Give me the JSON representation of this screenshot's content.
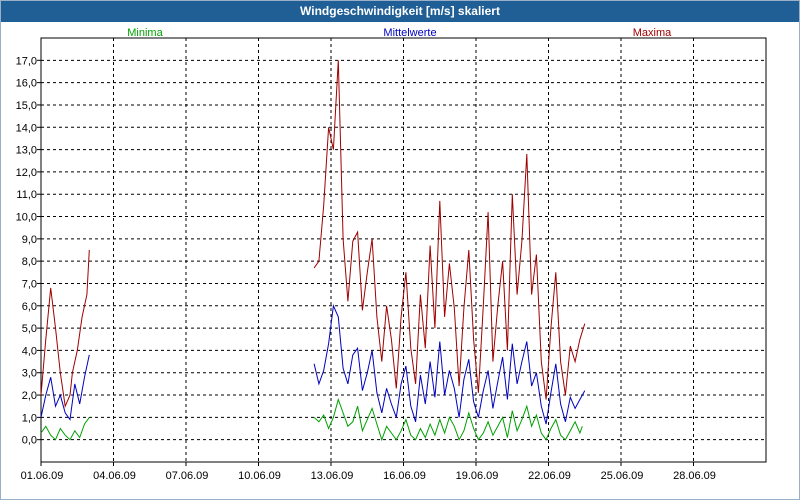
{
  "window": {
    "title": "Windgeschwindigkeit [m/s] skaliert"
  },
  "colors": {
    "min": "#00a000",
    "mean": "#0000c0",
    "max": "#a00000",
    "grid": "#000000"
  },
  "chart_data": {
    "type": "line",
    "title": "Windgeschwindigkeit [m/s] skaliert",
    "xlabel": "",
    "ylabel": "",
    "ylim": [
      -1,
      18
    ],
    "xlim": [
      "01.06.09",
      "01.07.09"
    ],
    "grid": true,
    "legend_position": "top",
    "x_ticks": [
      "01.06.09",
      "04.06.09",
      "07.06.09",
      "10.06.09",
      "13.06.09",
      "16.06.09",
      "19.06.09",
      "22.06.09",
      "25.06.09",
      "28.06.09"
    ],
    "y_ticks": [
      "0,0",
      "1,0",
      "2,0",
      "3,0",
      "4,0",
      "5,0",
      "6,0",
      "7,0",
      "8,0",
      "9,0",
      "10,0",
      "11,0",
      "12,0",
      "13,0",
      "14,0",
      "15,0",
      "16,0",
      "17,0"
    ],
    "series": [
      {
        "name": "Minima",
        "color": "#00a000",
        "segments": [
          [
            [
              0.0,
              0.3
            ],
            [
              0.2,
              0.6
            ],
            [
              0.4,
              0.2
            ],
            [
              0.6,
              0.0
            ],
            [
              0.8,
              0.5
            ],
            [
              1.0,
              0.2
            ],
            [
              1.2,
              0.0
            ],
            [
              1.4,
              0.4
            ],
            [
              1.6,
              0.1
            ],
            [
              1.8,
              0.7
            ],
            [
              2.0,
              1.0
            ]
          ],
          [
            [
              11.3,
              1.0
            ],
            [
              11.5,
              0.8
            ],
            [
              11.7,
              1.1
            ],
            [
              11.9,
              0.5
            ],
            [
              12.1,
              1.0
            ],
            [
              12.3,
              1.8
            ],
            [
              12.5,
              1.2
            ],
            [
              12.7,
              0.6
            ],
            [
              12.9,
              0.8
            ],
            [
              13.1,
              1.5
            ],
            [
              13.3,
              0.4
            ],
            [
              13.5,
              0.9
            ],
            [
              13.7,
              1.4
            ],
            [
              13.9,
              0.7
            ],
            [
              14.1,
              0.0
            ],
            [
              14.3,
              0.6
            ],
            [
              14.5,
              0.3
            ],
            [
              14.7,
              0.0
            ],
            [
              14.9,
              0.4
            ],
            [
              15.1,
              0.9
            ],
            [
              15.3,
              0.2
            ],
            [
              15.5,
              0.0
            ],
            [
              15.7,
              0.5
            ],
            [
              15.9,
              0.1
            ],
            [
              16.1,
              0.7
            ],
            [
              16.3,
              0.2
            ],
            [
              16.5,
              0.9
            ],
            [
              16.7,
              0.3
            ],
            [
              16.9,
              1.0
            ],
            [
              17.1,
              0.6
            ],
            [
              17.3,
              0.0
            ],
            [
              17.5,
              0.4
            ],
            [
              17.7,
              1.2
            ],
            [
              17.9,
              0.5
            ],
            [
              18.1,
              0.0
            ],
            [
              18.3,
              0.3
            ],
            [
              18.5,
              0.8
            ],
            [
              18.7,
              0.2
            ],
            [
              18.9,
              0.6
            ],
            [
              19.1,
              1.0
            ],
            [
              19.3,
              0.1
            ],
            [
              19.5,
              1.3
            ],
            [
              19.7,
              0.4
            ],
            [
              19.9,
              0.9
            ],
            [
              20.1,
              1.5
            ],
            [
              20.3,
              0.6
            ],
            [
              20.5,
              1.1
            ],
            [
              20.7,
              0.3
            ],
            [
              20.9,
              0.0
            ],
            [
              21.1,
              0.5
            ],
            [
              21.3,
              0.9
            ],
            [
              21.5,
              0.2
            ],
            [
              21.7,
              0.0
            ],
            [
              21.9,
              0.4
            ],
            [
              22.1,
              0.8
            ],
            [
              22.3,
              0.3
            ],
            [
              22.4,
              0.6
            ]
          ]
        ]
      },
      {
        "name": "Mittelwerte",
        "color": "#0000c0",
        "segments": [
          [
            [
              0.0,
              1.0
            ],
            [
              0.2,
              2.0
            ],
            [
              0.4,
              2.8
            ],
            [
              0.6,
              1.5
            ],
            [
              0.8,
              2.0
            ],
            [
              1.0,
              1.2
            ],
            [
              1.2,
              0.9
            ],
            [
              1.4,
              2.5
            ],
            [
              1.6,
              1.6
            ],
            [
              1.8,
              2.8
            ],
            [
              2.0,
              3.8
            ]
          ],
          [
            [
              11.3,
              3.4
            ],
            [
              11.5,
              2.5
            ],
            [
              11.7,
              3.1
            ],
            [
              11.9,
              4.3
            ],
            [
              12.1,
              6.0
            ],
            [
              12.3,
              5.5
            ],
            [
              12.5,
              3.2
            ],
            [
              12.7,
              2.5
            ],
            [
              12.9,
              3.8
            ],
            [
              13.1,
              4.1
            ],
            [
              13.3,
              2.2
            ],
            [
              13.5,
              3.0
            ],
            [
              13.7,
              4.0
            ],
            [
              13.9,
              2.1
            ],
            [
              14.1,
              1.2
            ],
            [
              14.3,
              2.3
            ],
            [
              14.5,
              1.6
            ],
            [
              14.7,
              1.0
            ],
            [
              14.9,
              2.5
            ],
            [
              15.1,
              3.3
            ],
            [
              15.3,
              1.5
            ],
            [
              15.5,
              0.8
            ],
            [
              15.7,
              2.9
            ],
            [
              15.9,
              1.6
            ],
            [
              16.1,
              3.5
            ],
            [
              16.3,
              1.9
            ],
            [
              16.5,
              4.4
            ],
            [
              16.7,
              2.0
            ],
            [
              16.9,
              3.1
            ],
            [
              17.1,
              2.3
            ],
            [
              17.3,
              1.0
            ],
            [
              17.5,
              2.7
            ],
            [
              17.7,
              3.6
            ],
            [
              17.9,
              1.7
            ],
            [
              18.1,
              1.0
            ],
            [
              18.3,
              2.2
            ],
            [
              18.5,
              3.1
            ],
            [
              18.7,
              1.4
            ],
            [
              18.9,
              2.6
            ],
            [
              19.1,
              3.7
            ],
            [
              19.3,
              1.8
            ],
            [
              19.5,
              4.3
            ],
            [
              19.7,
              2.5
            ],
            [
              19.9,
              3.5
            ],
            [
              20.1,
              4.4
            ],
            [
              20.3,
              2.4
            ],
            [
              20.5,
              3.0
            ],
            [
              20.7,
              1.5
            ],
            [
              20.9,
              0.7
            ],
            [
              21.1,
              2.1
            ],
            [
              21.3,
              3.4
            ],
            [
              21.5,
              1.6
            ],
            [
              21.7,
              0.8
            ],
            [
              21.9,
              1.9
            ],
            [
              22.1,
              1.4
            ],
            [
              22.3,
              1.8
            ],
            [
              22.5,
              2.2
            ]
          ]
        ]
      },
      {
        "name": "Maxima",
        "color": "#a00000",
        "segments": [
          [
            [
              0.0,
              2.0
            ],
            [
              0.2,
              4.5
            ],
            [
              0.4,
              6.8
            ],
            [
              0.6,
              5.0
            ],
            [
              0.8,
              3.0
            ],
            [
              1.0,
              1.5
            ],
            [
              1.2,
              2.0
            ],
            [
              1.3,
              3.0
            ],
            [
              1.5,
              4.0
            ],
            [
              1.7,
              5.5
            ],
            [
              1.9,
              6.5
            ],
            [
              2.0,
              8.5
            ]
          ],
          [
            [
              11.3,
              7.7
            ],
            [
              11.5,
              8.0
            ],
            [
              11.7,
              10.5
            ],
            [
              11.9,
              14.0
            ],
            [
              12.1,
              13.0
            ],
            [
              12.3,
              17.0
            ],
            [
              12.5,
              9.0
            ],
            [
              12.7,
              6.2
            ],
            [
              12.9,
              8.9
            ],
            [
              13.1,
              9.3
            ],
            [
              13.3,
              5.8
            ],
            [
              13.5,
              7.5
            ],
            [
              13.7,
              9.0
            ],
            [
              13.9,
              5.5
            ],
            [
              14.1,
              3.5
            ],
            [
              14.3,
              6.0
            ],
            [
              14.5,
              4.5
            ],
            [
              14.7,
              2.3
            ],
            [
              14.9,
              5.5
            ],
            [
              15.1,
              7.5
            ],
            [
              15.3,
              4.1
            ],
            [
              15.5,
              2.5
            ],
            [
              15.7,
              6.5
            ],
            [
              15.9,
              4.1
            ],
            [
              16.1,
              8.7
            ],
            [
              16.3,
              5.0
            ],
            [
              16.5,
              10.7
            ],
            [
              16.7,
              5.5
            ],
            [
              16.9,
              7.9
            ],
            [
              17.1,
              5.9
            ],
            [
              17.3,
              2.4
            ],
            [
              17.5,
              5.9
            ],
            [
              17.7,
              8.5
            ],
            [
              17.9,
              4.5
            ],
            [
              18.1,
              2.1
            ],
            [
              18.3,
              6.0
            ],
            [
              18.5,
              10.2
            ],
            [
              18.7,
              3.5
            ],
            [
              18.9,
              6.0
            ],
            [
              19.1,
              8.0
            ],
            [
              19.3,
              4.0
            ],
            [
              19.5,
              11.0
            ],
            [
              19.7,
              6.5
            ],
            [
              19.9,
              8.9
            ],
            [
              20.1,
              12.8
            ],
            [
              20.3,
              6.5
            ],
            [
              20.5,
              8.3
            ],
            [
              20.7,
              3.5
            ],
            [
              20.9,
              1.8
            ],
            [
              21.1,
              5.0
            ],
            [
              21.3,
              7.5
            ],
            [
              21.5,
              3.5
            ],
            [
              21.7,
              2.0
            ],
            [
              21.9,
              4.2
            ],
            [
              22.1,
              3.5
            ],
            [
              22.3,
              4.5
            ],
            [
              22.5,
              5.2
            ]
          ]
        ]
      }
    ]
  }
}
